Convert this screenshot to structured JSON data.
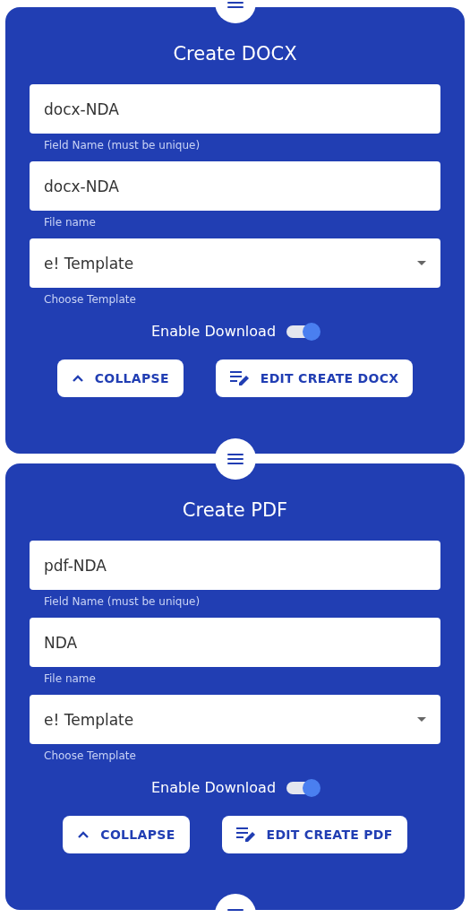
{
  "cards": [
    {
      "title": "Create DOCX",
      "fields": [
        {
          "kind": "text",
          "value": "docx-NDA",
          "helper": "Field Name (must be unique)"
        },
        {
          "kind": "text",
          "value": "docx-NDA",
          "helper": "File name"
        },
        {
          "kind": "select",
          "value": "e! Template",
          "helper": "Choose Template"
        }
      ],
      "toggle": {
        "label": "Enable Download",
        "on": true
      },
      "buttons": [
        {
          "kind": "collapse",
          "label": "COLLAPSE"
        },
        {
          "kind": "edit",
          "label": "EDIT CREATE DOCX"
        }
      ]
    },
    {
      "title": "Create PDF",
      "fields": [
        {
          "kind": "text",
          "value": "pdf-NDA",
          "helper": "Field Name (must be unique)"
        },
        {
          "kind": "text",
          "value": "NDA",
          "helper": "File name"
        },
        {
          "kind": "select",
          "value": "e! Template",
          "helper": "Choose Template"
        }
      ],
      "toggle": {
        "label": "Enable Download",
        "on": true
      },
      "buttons": [
        {
          "kind": "collapse",
          "label": "COLLAPSE"
        },
        {
          "kind": "edit",
          "label": "EDIT CREATE PDF"
        }
      ]
    }
  ]
}
